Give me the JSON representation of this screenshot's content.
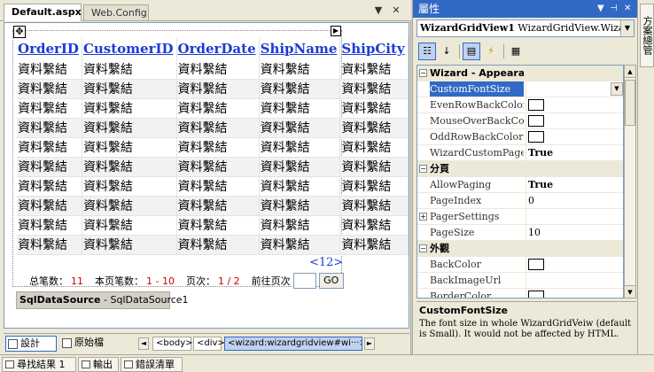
{
  "editor": {
    "tabs": [
      {
        "label": "Default.aspx",
        "active": true
      },
      {
        "label": "Web.Config",
        "active": false
      }
    ],
    "grid": {
      "columns": [
        "OrderID",
        "CustomerID",
        "OrderDate",
        "ShipName",
        "ShipCity"
      ],
      "cell_text": "資料繫結",
      "row_count": 10,
      "pager_link": "<12>",
      "pager_bar": {
        "total_label": "总笔数：",
        "total_value": "11",
        "page_rows_label": "本页笔数：",
        "page_rows_value": "1 - 10",
        "page_label": "页次：",
        "page_value": "1 / 2",
        "goto_label": "前往页次",
        "go_button": "GO"
      }
    },
    "sqldatasource": {
      "type": "SqlDataSource",
      "name": " - SqlDataSource1"
    },
    "view_bar": {
      "design": "設計",
      "source": "原始檔",
      "scroll_left": "◄",
      "scroll_right": "►",
      "crumbs": [
        "<body>",
        "<div>",
        "<wizard:wizardgridview#wi···>"
      ]
    }
  },
  "properties": {
    "title": "屬性",
    "object_name": "WizardGridView1",
    "object_type": "WizardGridView.WizardG",
    "rows": [
      {
        "kind": "cat",
        "expander": "⊟",
        "name": "Wizard - Appearance"
      },
      {
        "kind": "prop",
        "name": "CustomFontSize",
        "value": "",
        "selected": true,
        "dropdown": true
      },
      {
        "kind": "prop",
        "name": "EvenRowBackColor",
        "value": "",
        "swatch": true
      },
      {
        "kind": "prop",
        "name": "MouseOverBackColor",
        "value": "",
        "swatch": true
      },
      {
        "kind": "prop",
        "name": "OddRowBackColor",
        "value": "",
        "swatch": true
      },
      {
        "kind": "prop",
        "name": "WizardCustomPager",
        "value": "True",
        "bold": true
      },
      {
        "kind": "cat",
        "expander": "⊟",
        "name": "分頁"
      },
      {
        "kind": "prop",
        "name": "AllowPaging",
        "value": "True",
        "bold": true
      },
      {
        "kind": "prop",
        "name": "PageIndex",
        "value": "0"
      },
      {
        "kind": "prop",
        "name": "PagerSettings",
        "value": "",
        "expander": "⊞"
      },
      {
        "kind": "prop",
        "name": "PageSize",
        "value": "10"
      },
      {
        "kind": "cat",
        "expander": "⊟",
        "name": "外觀"
      },
      {
        "kind": "prop",
        "name": "BackColor",
        "value": "",
        "swatch": true
      },
      {
        "kind": "prop",
        "name": "BackImageUrl",
        "value": ""
      },
      {
        "kind": "prop",
        "name": "BorderColor",
        "value": "",
        "swatch": true
      }
    ],
    "description": {
      "title": "CustomFontSize",
      "text": "The font size in whole WizardGridVeiw (default is Small). It would not be affected by HTML."
    }
  },
  "right_strip": {
    "solution_tab": "方案總管"
  },
  "bottom_tabs": [
    "尋找結果 1",
    "輸出",
    "錯誤清單"
  ],
  "colors": {
    "header_link": "#1b3bd4",
    "pager_red": "#cc0000",
    "selection": "#316ac5"
  }
}
